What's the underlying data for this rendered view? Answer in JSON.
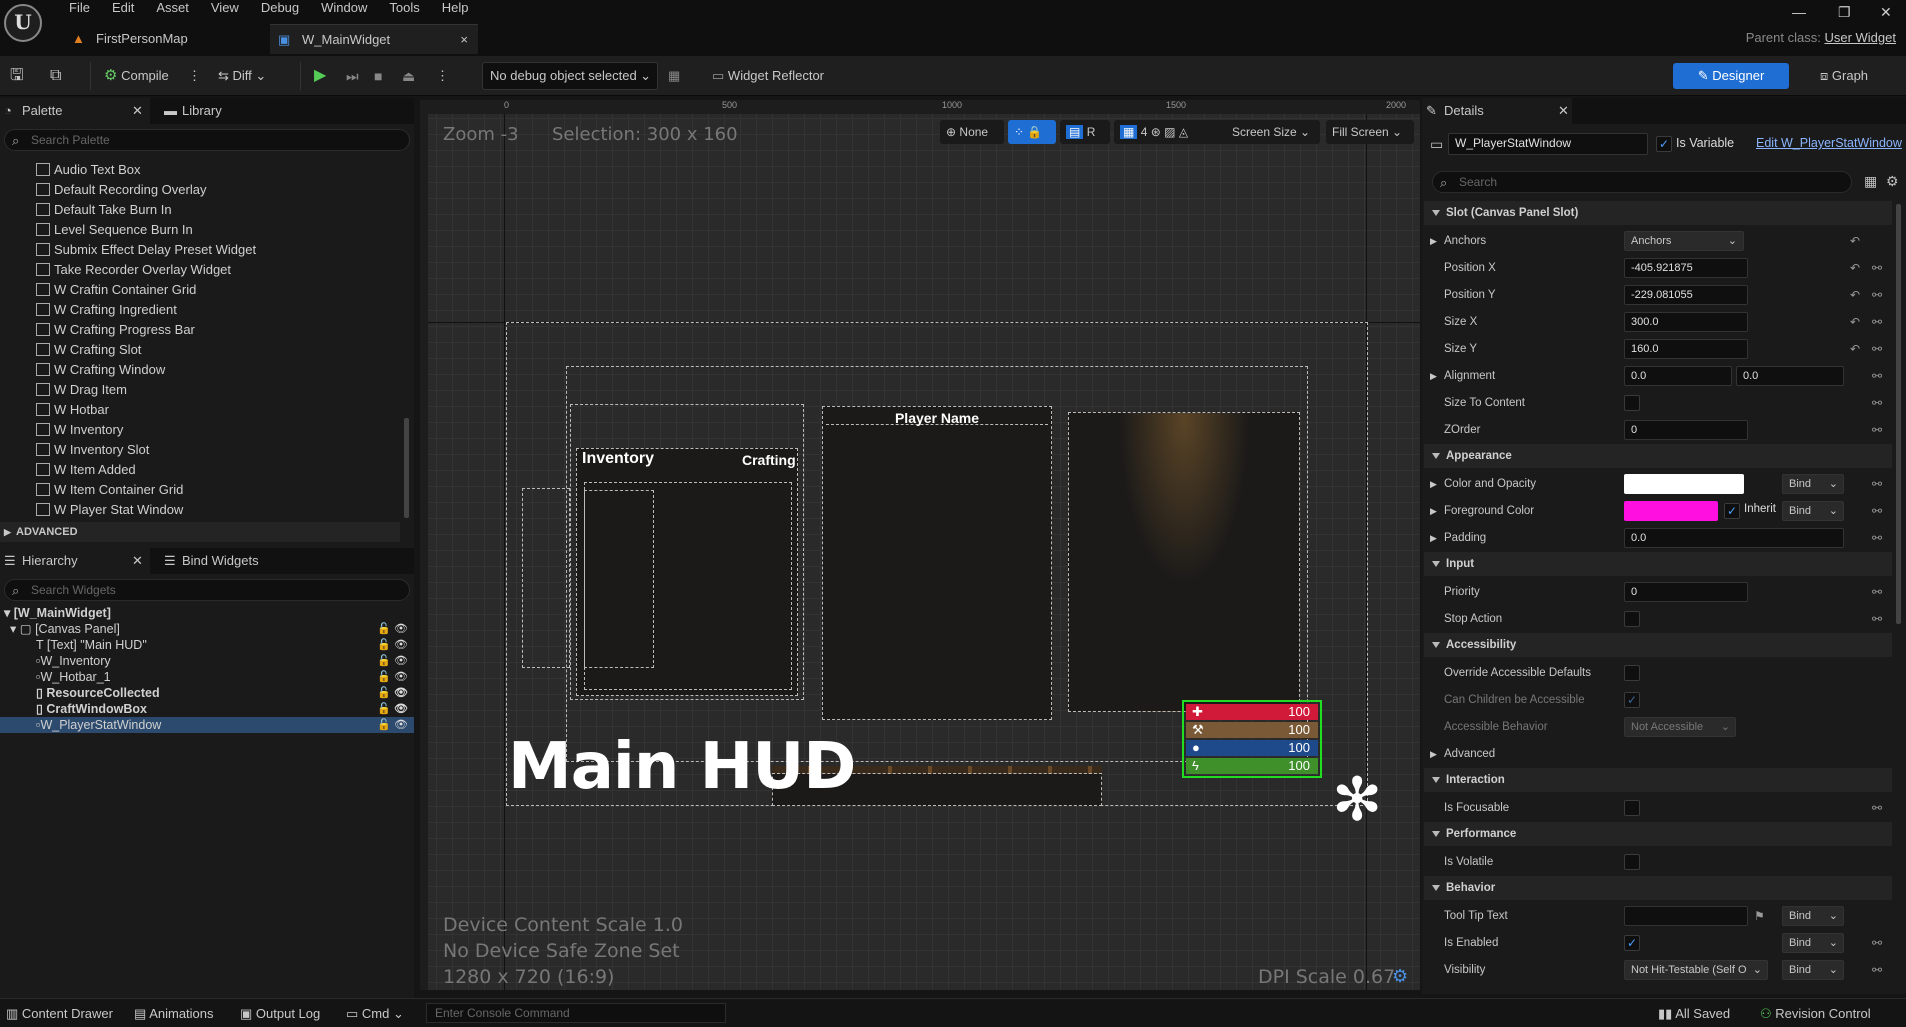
{
  "menu": [
    "File",
    "Edit",
    "Asset",
    "View",
    "Debug",
    "Window",
    "Tools",
    "Help"
  ],
  "tabs": {
    "map": "FirstPersonMap",
    "widget": "W_MainWidget",
    "close": "×"
  },
  "parent_class": {
    "label": "Parent class:",
    "value": "User Widget"
  },
  "toolbar": {
    "compile": "Compile",
    "diff": "Diff",
    "debug_select": "No debug object selected",
    "reflector": "Widget Reflector",
    "designer": "Designer",
    "graph": "Graph"
  },
  "palette": {
    "tab": "Palette",
    "library": "Library",
    "search_placeholder": "Search Palette",
    "items": [
      "Audio Text Box",
      "Default Recording Overlay",
      "Default Take Burn In",
      "Level Sequence Burn In",
      "Submix Effect Delay Preset Widget",
      "Take Recorder Overlay Widget",
      "W Craftin Container Grid",
      "W Crafting Ingredient",
      "W Crafting Progress Bar",
      "W Crafting Slot",
      "W Crafting Window",
      "W Drag Item",
      "W Hotbar",
      "W Inventory",
      "W Inventory Slot",
      "W Item Added",
      "W Item Container Grid",
      "W Player Stat Window"
    ],
    "advanced": "ADVANCED"
  },
  "hierarchy": {
    "tab": "Hierarchy",
    "bind": "Bind Widgets",
    "search_placeholder": "Search Widgets",
    "items": [
      "[W_MainWidget]",
      "[Canvas Panel]",
      "[Text] \"Main HUD\"",
      "W_Inventory",
      "W_Hotbar_1",
      "ResourceCollected",
      "CraftWindowBox",
      "W_PlayerStatWindow"
    ]
  },
  "canvas": {
    "zoom": "Zoom -3",
    "selection": "Selection: 300 x 160",
    "ruler": [
      "0",
      "500",
      "1000",
      "1500",
      "2000"
    ],
    "none": "None",
    "r": "R",
    "grid": "4",
    "screen_size": "Screen Size",
    "fill_screen": "Fill Screen",
    "inventory": "Inventory",
    "crafting": "Crafting",
    "player_name": "Player Name",
    "stats": [
      "100",
      "100",
      "100",
      "100"
    ],
    "main_hud": "Main HUD",
    "device_scale": "Device Content Scale 1.0",
    "safe_zone": "No Device Safe Zone Set",
    "resolution": "1280 x 720 (16:9)",
    "dpi": "DPI Scale 0.67"
  },
  "details": {
    "tab": "Details",
    "name": "W_PlayerStatWindow",
    "is_variable": "Is Variable",
    "edit_link": "Edit W_PlayerStatWindow",
    "search_placeholder": "Search",
    "slot_header": "Slot (Canvas Panel Slot)",
    "anchors_label": "Anchors",
    "anchors_value": "Anchors",
    "pos_x_label": "Position X",
    "pos_x": "-405.921875",
    "pos_y_label": "Position Y",
    "pos_y": "-229.081055",
    "size_x_label": "Size X",
    "size_x": "300.0",
    "size_y_label": "Size Y",
    "size_y": "160.0",
    "alignment_label": "Alignment",
    "align_x": "0.0",
    "align_y": "0.0",
    "size_to_content": "Size To Content",
    "zorder_label": "ZOrder",
    "zorder": "0",
    "appearance": "Appearance",
    "color_opacity": "Color and Opacity",
    "foreground": "Foreground Color",
    "inherit": "Inherit",
    "bind": "Bind",
    "padding_label": "Padding",
    "padding": "0.0",
    "input": "Input",
    "priority_label": "Priority",
    "priority": "0",
    "stop_action": "Stop Action",
    "accessibility": "Accessibility",
    "override_acc": "Override Accessible Defaults",
    "children_acc": "Can Children be Accessible",
    "acc_behavior": "Accessible Behavior",
    "not_accessible": "Not Accessible",
    "advanced": "Advanced",
    "interaction": "Interaction",
    "is_focusable": "Is Focusable",
    "performance": "Performance",
    "is_volatile": "Is Volatile",
    "behavior": "Behavior",
    "tooltip": "Tool Tip Text",
    "is_enabled": "Is Enabled",
    "visibility": "Visibility",
    "visibility_value": "Not Hit-Testable (Self O"
  },
  "status": {
    "content_drawer": "Content Drawer",
    "animations": "Animations",
    "output_log": "Output Log",
    "cmd": "Cmd",
    "console_placeholder": "Enter Console Command",
    "all_saved": "All Saved",
    "revision": "Revision Control"
  },
  "colors": {
    "accent": "#1f6ed4",
    "health": "#d11a3a",
    "stamina": "#7a5a36",
    "water": "#1e4a8c",
    "energy": "#3f8f2a",
    "foreground": "#ff10e0",
    "selection": "#22dd22"
  }
}
